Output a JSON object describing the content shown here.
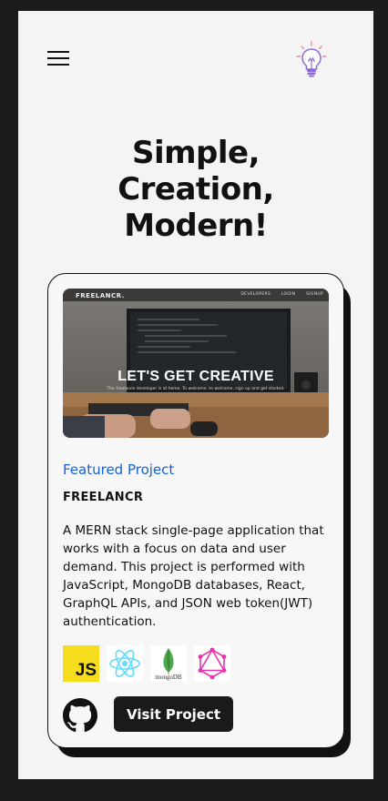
{
  "header": {
    "menu_icon": "hamburger-menu-icon",
    "logo_icon": "lightbulb-icon"
  },
  "hero": {
    "title_line1": "Simple,",
    "title_line2": "Creation,",
    "title_line3": "Modern!"
  },
  "project": {
    "screenshot": {
      "brand": "FREELANCR.",
      "nav_items": [
        "DEVELOPERS",
        "LOGIN",
        "SIGNUP"
      ],
      "headline": "LET'S GET CREATIVE",
      "tagline": "The freelance developer is at home. To welcome, to welcome, sign up and get started."
    },
    "label": "Featured Project",
    "name": "FREELANCR",
    "description": "A MERN stack single-page application that works with a focus on data and user demand. This project is performed with JavaScript, MongoDB databases, React, GraphQL APIs, and JSON web token(JWT) authentication.",
    "tech_icons": [
      "javascript-icon",
      "react-icon",
      "mongodb-icon",
      "graphql-icon"
    ],
    "js_label": "JS",
    "mongo_label": "mongoDB",
    "github_icon": "github-icon",
    "visit_label": "Visit Project"
  },
  "colors": {
    "accent_blue": "#1560d6",
    "page_bg": "#f4f4f4",
    "frame_bg": "#1c1c1c",
    "button_bg": "#1a1a1a",
    "js_yellow": "#f5dd1e",
    "react_cyan": "#61dafb",
    "mongo_green": "#4fa94d",
    "graphql_pink": "#e535ab"
  }
}
